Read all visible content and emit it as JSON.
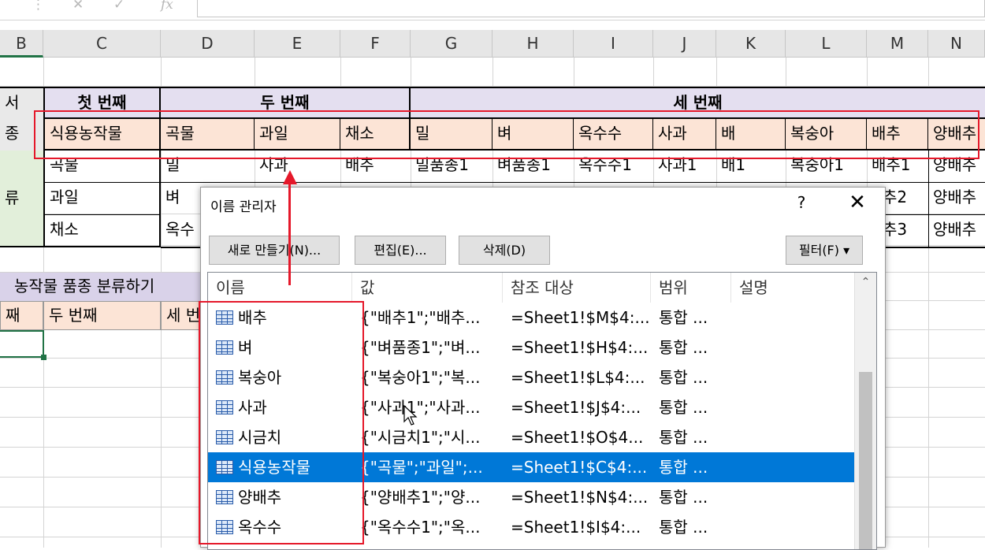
{
  "formula_bar": {
    "fx": "fx",
    "cancel": "✕",
    "enter": "✓"
  },
  "columns": [
    "B",
    "C",
    "D",
    "E",
    "F",
    "G",
    "H",
    "I",
    "J",
    "K",
    "L",
    "M",
    "N"
  ],
  "sheet": {
    "row3": {
      "b": "서",
      "first": "첫 번째",
      "second": "두 번째",
      "third": "세 번째"
    },
    "row4": [
      "종",
      "식용농작물",
      "곡물",
      "과일",
      "채소",
      "밀",
      "벼",
      "옥수수",
      "사과",
      "배",
      "복숭아",
      "배추",
      "양배추"
    ],
    "row5": [
      "곡물",
      "밀",
      "사과",
      "배추",
      "밀품종1",
      "벼품종1",
      "옥수수1",
      "사과1",
      "배1",
      "복숭아1",
      "배추1",
      "양배추"
    ],
    "row6": {
      "b": "류",
      "c": "과일",
      "d": "벼",
      "m": "추2",
      "n": "양배추"
    },
    "row7": {
      "c": "채소",
      "d": "옥수",
      "m": "추3",
      "n": "양배추"
    },
    "classify_title": "농작물 품종 분류하기",
    "row10": {
      "b": "째",
      "c": "두 번째",
      "d": "세 번"
    }
  },
  "dialog": {
    "title": "이름 관리자",
    "help": "?",
    "close": "✕",
    "buttons": {
      "new": "새로 만들기(N)...",
      "edit": "편집(E)...",
      "delete": "삭제(D)",
      "filter": "필터(F) ▾"
    },
    "headers": {
      "name": "이름",
      "value": "값",
      "refers_to": "참조 대상",
      "scope": "범위",
      "comment": "설명"
    },
    "rows": [
      {
        "name": "배추",
        "value": "{\"배추1\";\"배추...",
        "ref": "=Sheet1!$M$4:...",
        "scope": "통합 ..."
      },
      {
        "name": "벼",
        "value": "{\"벼품종1\";\"벼...",
        "ref": "=Sheet1!$H$4:...",
        "scope": "통합 ..."
      },
      {
        "name": "복숭아",
        "value": "{\"복숭아1\";\"복...",
        "ref": "=Sheet1!$L$4:...",
        "scope": "통합 ..."
      },
      {
        "name": "사과",
        "value": "{\"사과1\";\"사과...",
        "ref": "=Sheet1!$J$4:...",
        "scope": "통합 ..."
      },
      {
        "name": "시금치",
        "value": "{\"시금치1\";\"시...",
        "ref": "=Sheet1!$O$4...",
        "scope": "통합 ..."
      },
      {
        "name": "식용농작물",
        "value": "{\"곡물\";\"과일\";...",
        "ref": "=Sheet1!$C$4:...",
        "scope": "통합 ...",
        "selected": true
      },
      {
        "name": "양배추",
        "value": "{\"양배추1\";\"양...",
        "ref": "=Sheet1!$N$4:...",
        "scope": "통합 ..."
      },
      {
        "name": "옥수수",
        "value": "{\"옥수수1\";\"옥...",
        "ref": "=Sheet1!$I$4:...",
        "scope": "통합 ..."
      }
    ]
  },
  "colors": {
    "header_fill": "#fce4d6",
    "subheader_fill": "#e4dff0",
    "section_fill": "#d9d2e9",
    "accent_red": "#e5182a",
    "selection": "#0078d7"
  }
}
